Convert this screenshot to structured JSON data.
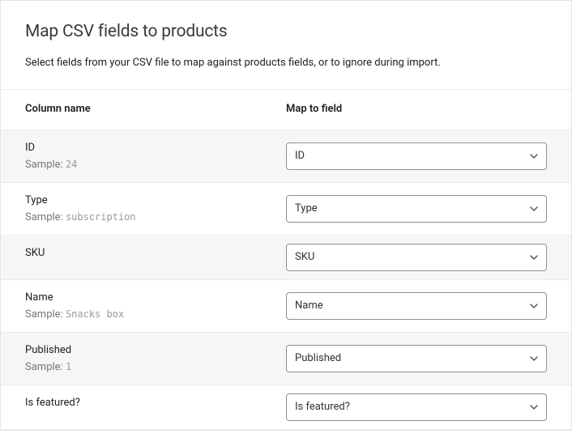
{
  "header": {
    "title": "Map CSV fields to products",
    "description": "Select fields from your CSV file to map against products fields, or to ignore during import."
  },
  "table": {
    "headers": {
      "column_name": "Column name",
      "map_to_field": "Map to field"
    },
    "sample_prefix": "Sample:",
    "rows": [
      {
        "column_label": "ID",
        "sample": "24",
        "selected": "ID"
      },
      {
        "column_label": "Type",
        "sample": "subscription",
        "selected": "Type"
      },
      {
        "column_label": "SKU",
        "sample": "",
        "selected": "SKU"
      },
      {
        "column_label": "Name",
        "sample": "Snacks box",
        "selected": "Name"
      },
      {
        "column_label": "Published",
        "sample": "1",
        "selected": "Published"
      },
      {
        "column_label": "Is featured?",
        "sample": "",
        "selected": "Is featured?"
      }
    ]
  }
}
